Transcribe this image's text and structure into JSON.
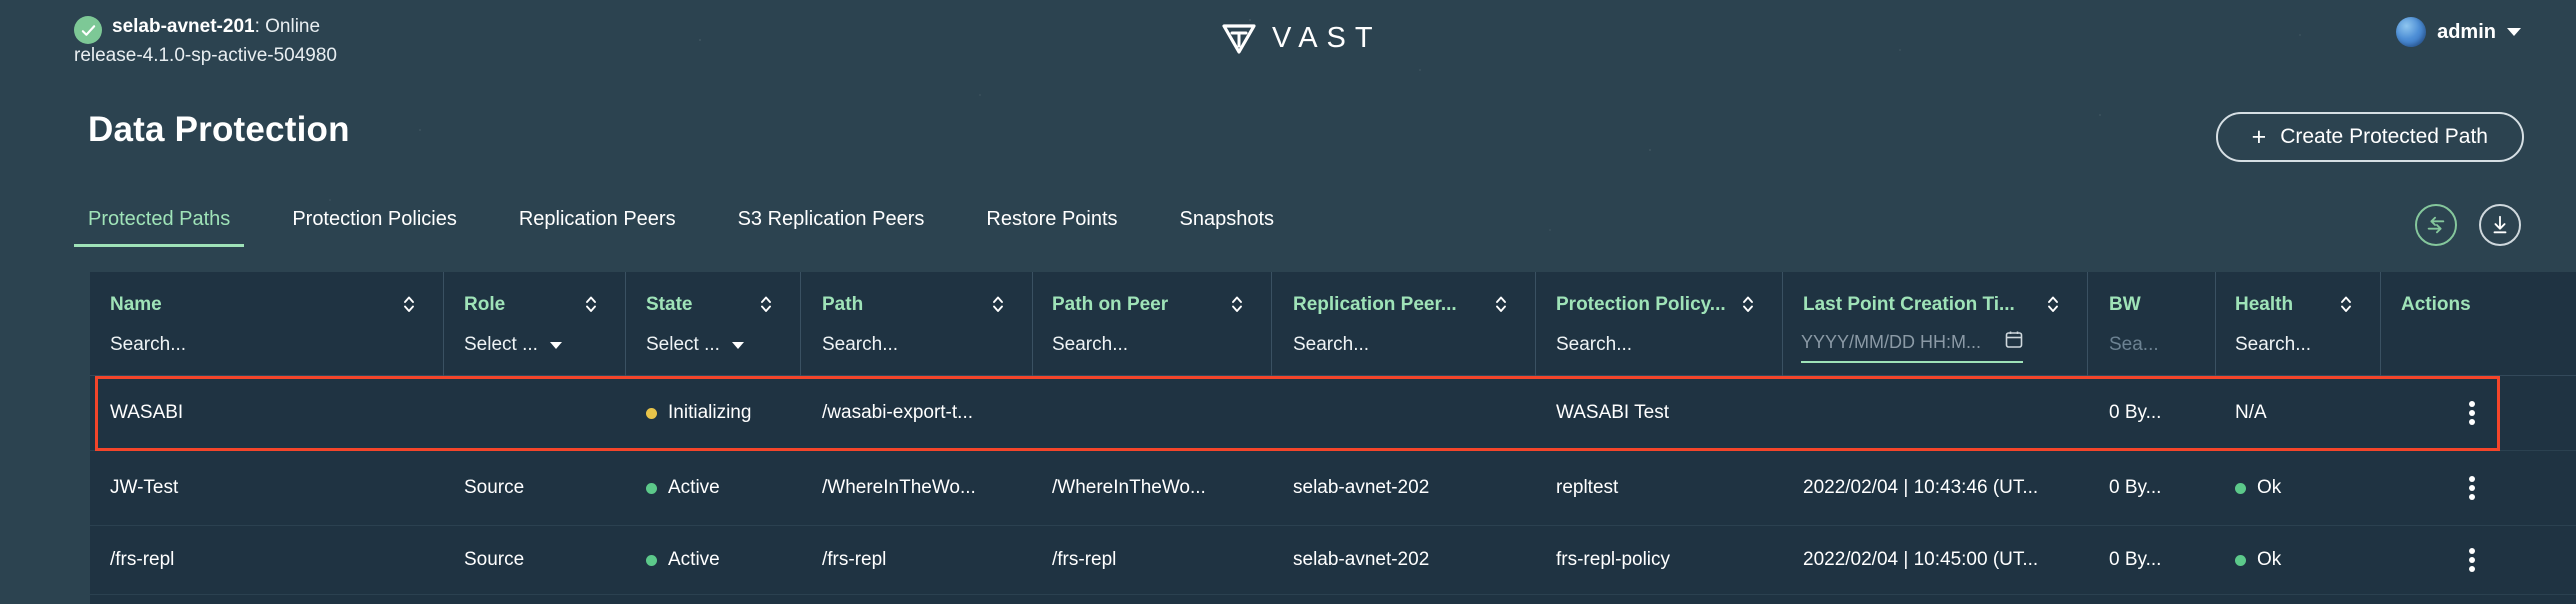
{
  "header": {
    "cluster_name": "selab-avnet-201",
    "cluster_status": "Online",
    "cluster_status_sep": ": ",
    "release": "release-4.1.0-sp-active-504980",
    "status_icon": "check-circle-icon",
    "logo_text": "VAST",
    "logo_mark": "vast-triangle-logo",
    "user": "admin",
    "user_avatar": "globe-avatar-icon",
    "user_caret": "chevron-down-icon"
  },
  "page": {
    "title": "Data Protection",
    "create_button": "Create Protected Path",
    "create_button_icon": "plus-icon"
  },
  "tabs": [
    {
      "label": "Protected Paths",
      "active": true
    },
    {
      "label": "Protection Policies",
      "active": false
    },
    {
      "label": "Replication Peers",
      "active": false
    },
    {
      "label": "S3 Replication Peers",
      "active": false
    },
    {
      "label": "Restore Points",
      "active": false
    },
    {
      "label": "Snapshots",
      "active": false
    }
  ],
  "tab_actions": [
    {
      "name": "refresh-sync-icon",
      "accent": "#85c79c"
    },
    {
      "name": "download-icon",
      "accent": "#cfd8dd"
    }
  ],
  "table": {
    "columns": [
      {
        "header": "Name",
        "sortable": true,
        "filter": "Search...",
        "filter_type": "search"
      },
      {
        "header": "Role",
        "sortable": true,
        "filter": "Select ...",
        "filter_type": "select"
      },
      {
        "header": "State",
        "sortable": true,
        "filter": "Select ...",
        "filter_type": "select"
      },
      {
        "header": "Path",
        "sortable": true,
        "filter": "Search...",
        "filter_type": "search"
      },
      {
        "header": "Path on Peer",
        "sortable": true,
        "filter": "Search...",
        "filter_type": "search"
      },
      {
        "header": "Replication Peer...",
        "sortable": true,
        "filter": "Search...",
        "filter_type": "search"
      },
      {
        "header": "Protection Policy...",
        "sortable": true,
        "filter": "Search...",
        "filter_type": "search"
      },
      {
        "header": "Last Point Creation Ti...",
        "sortable": true,
        "filter": "YYYY/MM/DD HH:M...",
        "filter_type": "date"
      },
      {
        "header": "BW",
        "sortable": false,
        "filter": "Sea...",
        "filter_type": "search-dim"
      },
      {
        "header": "Health",
        "sortable": true,
        "filter": "Search...",
        "filter_type": "search"
      },
      {
        "header": "Actions",
        "sortable": false,
        "filter": "",
        "filter_type": "none"
      }
    ],
    "rows": [
      {
        "name": "WASABI",
        "role": "",
        "state": "Initializing",
        "state_dot": "#e8c44a",
        "path": "/wasabi-export-t...",
        "path_on_peer": "",
        "replication_peer": "",
        "protection_policy": "WASABI Test",
        "last_point_creation": "",
        "bw": "0 By...",
        "health": "N/A",
        "health_dot": "",
        "highlighted": true,
        "actions_icon": "kebab-menu-icon"
      },
      {
        "name": "JW-Test",
        "role": "Source",
        "state": "Active",
        "state_dot": "#5cc98a",
        "path": "/WhereInTheWo...",
        "path_on_peer": "/WhereInTheWo...",
        "replication_peer": "selab-avnet-202",
        "protection_policy": "repltest",
        "last_point_creation": "2022/02/04 | 10:43:46 (UT...",
        "bw": "0 By...",
        "health": "Ok",
        "health_dot": "#5cc98a",
        "highlighted": false,
        "actions_icon": "kebab-menu-icon"
      },
      {
        "name": "/frs-repl",
        "role": "Source",
        "state": "Active",
        "state_dot": "#5cc98a",
        "path": "/frs-repl",
        "path_on_peer": "/frs-repl",
        "replication_peer": "selab-avnet-202",
        "protection_policy": "frs-repl-policy",
        "last_point_creation": "2022/02/04 | 10:45:00 (UT...",
        "bw": "0 By...",
        "health": "Ok",
        "health_dot": "#5cc98a",
        "highlighted": false,
        "actions_icon": "kebab-menu-icon"
      }
    ]
  },
  "colors": {
    "accent_green": "#9fe3b8",
    "page_bg": "#2c4350",
    "table_bg": "#1f3342",
    "highlight_red": "#f4452a",
    "status_ok": "#5cc98a",
    "status_init": "#e8c44a"
  }
}
